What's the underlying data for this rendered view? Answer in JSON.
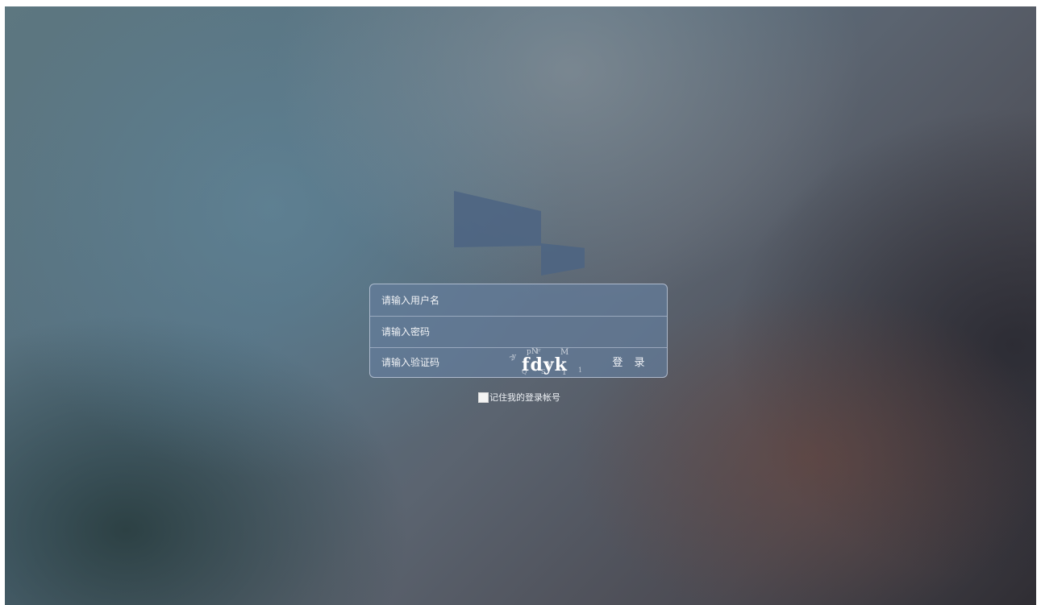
{
  "login": {
    "username_placeholder": "请输入用户名",
    "password_placeholder": "请输入密码",
    "captcha_placeholder": "请输入验证码",
    "captcha_text": "fdyk",
    "login_button": "登 录",
    "remember_label": "记住我的登录帐号",
    "remember_checked": false
  },
  "colors": {
    "box_fill": "#647d9b",
    "logo_fill": "#4c6482",
    "text": "#f4f6fa"
  },
  "icons": {
    "logo": "brand-logo-shape",
    "checkbox": "checkbox-square"
  }
}
